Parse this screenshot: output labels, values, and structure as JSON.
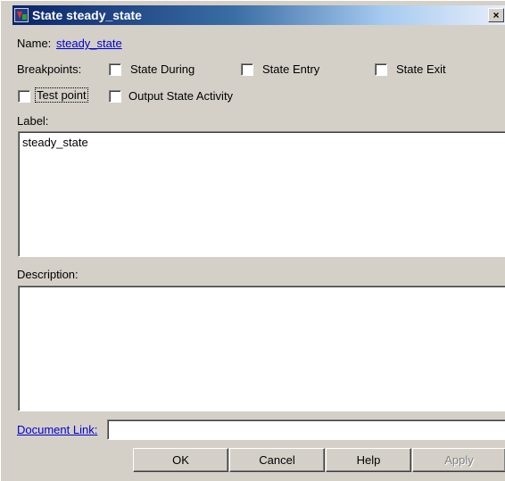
{
  "window": {
    "title": "State steady_state",
    "close_glyph": "×",
    "icon": "stateflow-app-icon"
  },
  "name_row": {
    "label": "Name:",
    "value": "steady_state"
  },
  "breakpoints": {
    "label": "Breakpoints:",
    "state_during": {
      "label": "State During",
      "checked": false
    },
    "state_entry": {
      "label": "State Entry",
      "checked": false
    },
    "state_exit": {
      "label": "State Exit",
      "checked": false
    }
  },
  "options": {
    "test_point": {
      "label": "Test point",
      "checked": false
    },
    "output_state_activity": {
      "label": "Output State Activity",
      "checked": false
    }
  },
  "label_field": {
    "caption": "Label:",
    "value": "steady_state"
  },
  "description_field": {
    "caption": "Description:",
    "value": ""
  },
  "document_link": {
    "caption": "Document Link:",
    "value": ""
  },
  "buttons": {
    "ok": "OK",
    "cancel": "Cancel",
    "help": "Help",
    "apply": "Apply"
  },
  "colors": {
    "dialog_bg": "#d4d0c8",
    "title_start": "#0a246a",
    "title_end": "#a6caf0",
    "link": "#0000cc"
  }
}
